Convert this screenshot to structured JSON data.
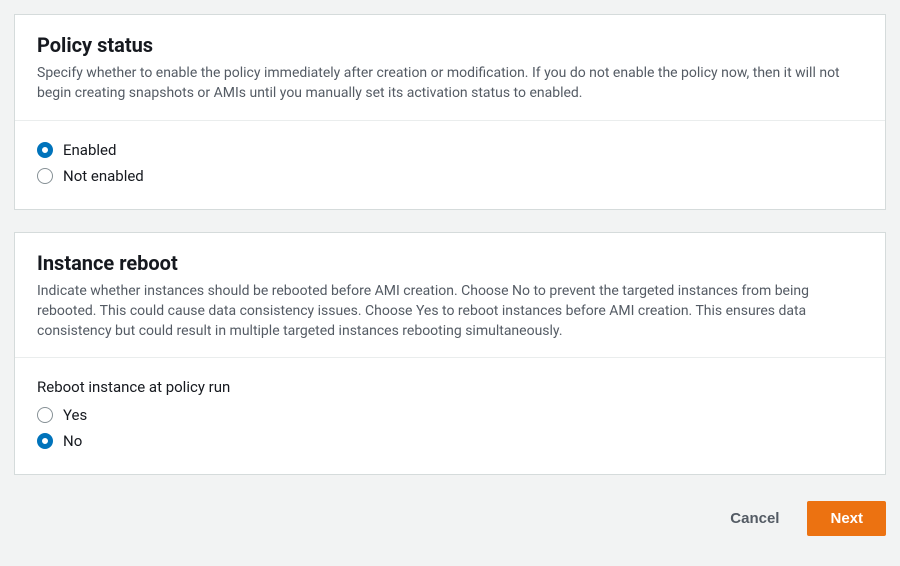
{
  "policyStatus": {
    "title": "Policy status",
    "description": "Specify whether to enable the policy immediately after creation or modification. If you do not enable the policy now, then it will not begin creating snapshots or AMIs until you manually set its activation status to enabled.",
    "options": {
      "enabled": "Enabled",
      "notEnabled": "Not enabled"
    },
    "selected": "enabled"
  },
  "instanceReboot": {
    "title": "Instance reboot",
    "description": "Indicate whether instances should be rebooted before AMI creation. Choose No to prevent the targeted instances from being rebooted. This could cause data consistency issues. Choose Yes to reboot instances before AMI creation. This ensures data consistency but could result in multiple targeted instances rebooting simultaneously.",
    "fieldLabel": "Reboot instance at policy run",
    "options": {
      "yes": "Yes",
      "no": "No"
    },
    "selected": "no"
  },
  "footer": {
    "cancel": "Cancel",
    "next": "Next"
  }
}
